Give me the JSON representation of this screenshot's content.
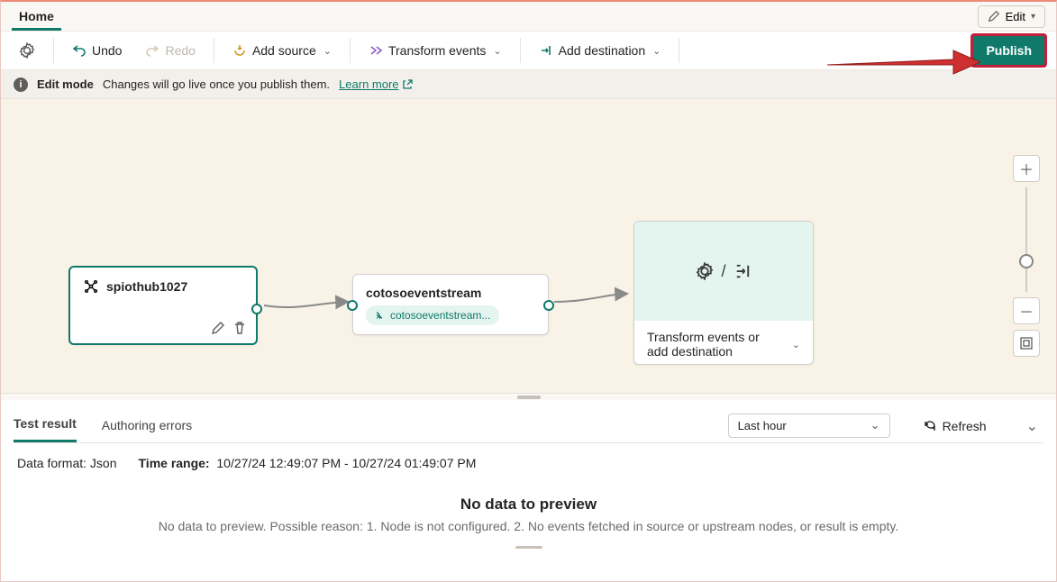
{
  "tabs": {
    "home": "Home"
  },
  "edit_button": "Edit",
  "toolbar": {
    "undo": "Undo",
    "redo": "Redo",
    "add_source": "Add source",
    "transform": "Transform events",
    "add_dest": "Add destination",
    "publish": "Publish"
  },
  "infobar": {
    "mode": "Edit mode",
    "msg": "Changes will go live once you publish them.",
    "learn_more": "Learn more"
  },
  "nodes": {
    "source": {
      "label": "spiothub1027"
    },
    "stream": {
      "label": "cotosoeventstream",
      "chip": "cotosoeventstream..."
    },
    "target": {
      "label": "Transform events or add destination"
    }
  },
  "bottom": {
    "tabs": {
      "test_result": "Test result",
      "authoring_errors": "Authoring errors"
    },
    "time_select": "Last hour",
    "refresh": "Refresh",
    "data_format_label": "Data format:",
    "data_format_value": "Json",
    "time_range_label": "Time range:",
    "time_range_value": "10/27/24 12:49:07 PM - 10/27/24 01:49:07 PM",
    "no_data_title": "No data to preview",
    "no_data_msg": "No data to preview. Possible reason: 1. Node is not configured. 2. No events fetched in source or upstream nodes, or result is empty."
  }
}
